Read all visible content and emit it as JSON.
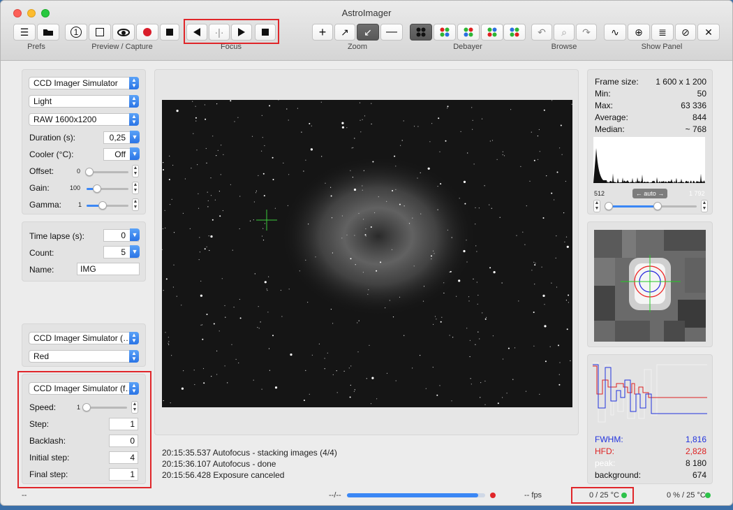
{
  "window": {
    "title": "AstroImager"
  },
  "toolbar": {
    "groups": [
      {
        "label": "Prefs"
      },
      {
        "label": "Preview / Capture"
      },
      {
        "label": "Focus"
      },
      {
        "label": "Zoom"
      },
      {
        "label": "Debayer"
      },
      {
        "label": "Browse"
      },
      {
        "label": "Show Panel"
      }
    ]
  },
  "camera_panel": {
    "camera": "CCD Imager Simulator",
    "frame_type": "Light",
    "mode": "RAW 1600x1200",
    "duration_label": "Duration (s):",
    "duration": "0,25",
    "cooler_label": "Cooler (°C):",
    "cooler": "Off",
    "offset_label": "Offset:",
    "offset": "0",
    "gain_label": "Gain:",
    "gain": "100",
    "gamma_label": "Gamma:",
    "gamma": "1"
  },
  "sequence_panel": {
    "timelapse_label": "Time lapse (s):",
    "timelapse": "0",
    "count_label": "Count:",
    "count": "5",
    "name_label": "Name:",
    "name": "IMG"
  },
  "filter_panel": {
    "wheel": "CCD Imager Simulator (…",
    "filter": "Red"
  },
  "focuser_panel": {
    "focuser": "CCD Imager Simulator (f…",
    "speed_label": "Speed:",
    "speed": "1",
    "step_label": "Step:",
    "step": "1",
    "backlash_label": "Backlash:",
    "backlash": "0",
    "initial_label": "Initial step:",
    "initial": "4",
    "final_label": "Final step:",
    "final": "1"
  },
  "stats": {
    "rows": [
      {
        "k": "Frame size:",
        "v": "1 600 x 1 200"
      },
      {
        "k": "Min:",
        "v": "50"
      },
      {
        "k": "Max:",
        "v": "63 336"
      },
      {
        "k": "Average:",
        "v": "844"
      },
      {
        "k": "Median:",
        "v": "~ 768"
      }
    ],
    "hist_low": "512",
    "hist_mode": "← auto →",
    "hist_high": "1 792"
  },
  "focus_metrics": {
    "fwhm_label": "FWHM:",
    "fwhm": "1,816",
    "hfd_label": "HFD:",
    "hfd": "2,828",
    "peak_label": "peak:",
    "peak": "8 180",
    "bg_label": "background:",
    "bg": "674"
  },
  "log": [
    "20:15:35.537 Autofocus - stacking images (4/4)",
    "20:15:36.107 Autofocus - done",
    "20:15:56.428 Exposure canceled"
  ],
  "status": {
    "left": "--",
    "progress_text": "--/--",
    "progress": 0.95,
    "fps": "-- fps",
    "cooler": "0 / 25 °C",
    "power": "0 % / 25 °C"
  },
  "colors": {
    "fwhm": "#2233dd",
    "hfd": "#dd2222",
    "accent": "#2a74e6",
    "ok": "#2ec24a",
    "alert": "#e0262a"
  }
}
